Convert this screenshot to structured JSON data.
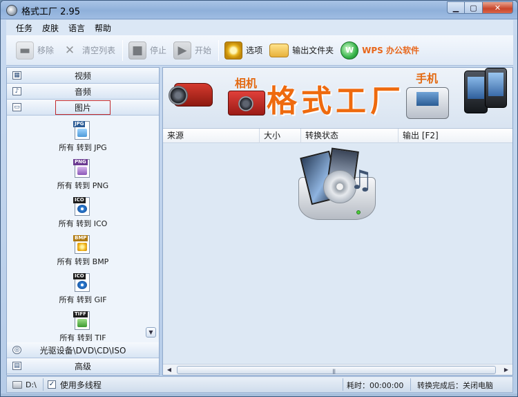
{
  "window": {
    "title": "格式工厂 2.95"
  },
  "menubar": {
    "items": [
      "任务",
      "皮肤",
      "语言",
      "帮助"
    ]
  },
  "toolbar": {
    "remove": "移除",
    "clear": "清空列表",
    "stop": "停止",
    "start": "开始",
    "options": "选项",
    "output_folder": "输出文件夹",
    "wps": "WPS 办公软件"
  },
  "sidebar": {
    "categories_top": [
      {
        "label": "视频",
        "icon": "video-icon"
      },
      {
        "label": "音频",
        "icon": "audio-icon"
      },
      {
        "label": "图片",
        "icon": "picture-icon",
        "active": true
      }
    ],
    "formats": [
      {
        "tag": "JPG",
        "label": "所有 转到 JPG"
      },
      {
        "tag": "PNG",
        "label": "所有 转到 PNG"
      },
      {
        "tag": "ICO",
        "label": "所有 转到 ICO"
      },
      {
        "tag": "BMP",
        "label": "所有 转到 BMP"
      },
      {
        "tag": "ICO",
        "label": "所有 转到 GIF"
      },
      {
        "tag": "TIFF",
        "label": "所有 转到 TIF"
      }
    ],
    "categories_bottom": [
      {
        "label": "光驱设备\\DVD\\CD\\ISO",
        "icon": "disc-icon"
      },
      {
        "label": "高级",
        "icon": "advanced-icon"
      }
    ]
  },
  "banner": {
    "camera_text": "相机",
    "main_text": "格式工厂",
    "phone_text": "手机"
  },
  "table": {
    "columns": [
      "来源",
      "大小",
      "转换状态",
      "输出 [F2]"
    ]
  },
  "statusbar": {
    "drive": "D:\\",
    "multithread_label": "使用多线程",
    "multithread_checked": "✓",
    "elapsed": "耗时：00:00:00",
    "after_convert": "转换完成后：关闭电脑"
  }
}
